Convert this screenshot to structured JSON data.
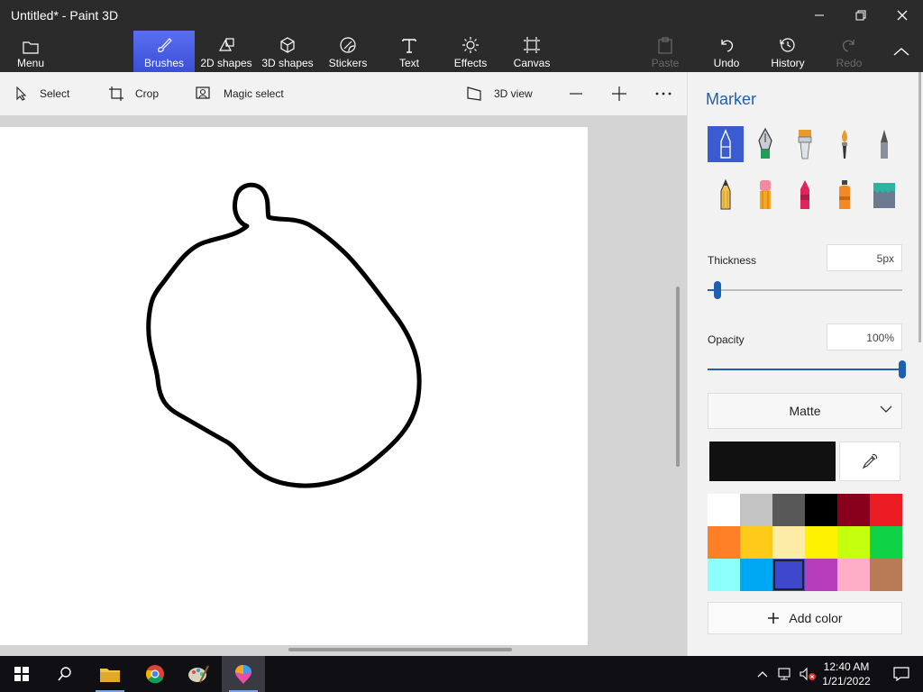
{
  "window": {
    "title": "Untitled* - Paint 3D"
  },
  "ribbon": {
    "menu": "Menu",
    "brushes": "Brushes",
    "shapes2d": "2D shapes",
    "shapes3d": "3D shapes",
    "stickers": "Stickers",
    "text": "Text",
    "effects": "Effects",
    "canvas": "Canvas",
    "paste": "Paste",
    "undo": "Undo",
    "history": "History",
    "redo": "Redo"
  },
  "toolbar": {
    "select": "Select",
    "crop": "Crop",
    "magic_select": "Magic select",
    "view3d": "3D view"
  },
  "panel": {
    "title": "Marker",
    "brushes": [
      "marker",
      "calligraphy-pen",
      "oil-brush",
      "watercolor",
      "pixel-pen",
      "pencil",
      "eraser",
      "crayon",
      "spray-can",
      "fill"
    ],
    "thickness_label": "Thickness",
    "thickness_value": "5px",
    "thickness_level": 0.05,
    "opacity_label": "Opacity",
    "opacity_value": "100%",
    "opacity_level": 1.0,
    "material": "Matte",
    "current_color": "#111111",
    "palette": [
      "#ffffff",
      "#c3c3c3",
      "#585858",
      "#000000",
      "#88001b",
      "#ec1c24",
      "#ff7f27",
      "#ffca18",
      "#fdeca6",
      "#fff200",
      "#c4ff0e",
      "#0ed145",
      "#8cfffb",
      "#00a8f3",
      "#3f48cc",
      "#b83dba",
      "#ffaec8",
      "#b97a56"
    ],
    "selected_swatch": 14,
    "add_color": "Add color"
  },
  "taskbar": {
    "time": "12:40 AM",
    "date": "1/21/2022"
  }
}
